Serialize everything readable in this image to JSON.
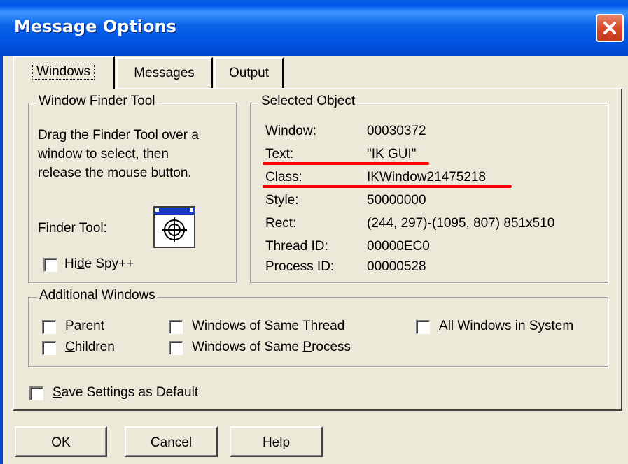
{
  "window": {
    "title": "Message Options"
  },
  "tabs": [
    {
      "label": "Windows"
    },
    {
      "label": "Messages"
    },
    {
      "label": "Output"
    }
  ],
  "finder": {
    "group_label": "Window Finder Tool",
    "instructions": [
      "Drag the Finder Tool over a",
      "window to select, then",
      "release the mouse button."
    ],
    "tool_label": "Finder Tool:",
    "hide_spy_pre": "Hi",
    "hide_spy_key": "d",
    "hide_spy_post": "e Spy++"
  },
  "selected": {
    "group_label": "Selected Object",
    "rows": [
      {
        "label": "Window:",
        "value": "00030372"
      },
      {
        "label_key": "T",
        "label_rest": "ext:",
        "value": "\"IK GUI\""
      },
      {
        "label_key": "C",
        "label_rest": "lass:",
        "value": "IKWindow21475218"
      },
      {
        "label": "Style:",
        "value": "50000000"
      },
      {
        "label": "Rect:",
        "value": "(244, 297)-(1095, 807) 851x510"
      },
      {
        "label": "Thread ID:",
        "value": "00000EC0"
      },
      {
        "label": "Process ID:",
        "value": "00000528"
      }
    ]
  },
  "additional": {
    "group_label": "Additional Windows",
    "parent_pre": "",
    "parent_key": "P",
    "parent_post": "arent",
    "children_pre": "",
    "children_key": "C",
    "children_post": "hildren",
    "same_thread_pre": "Windows of Same ",
    "same_thread_key": "T",
    "same_thread_post": "hread",
    "same_process_pre": "Windows of Same ",
    "same_process_key": "P",
    "same_process_post": "rocess",
    "all_windows_pre": "",
    "all_windows_key": "A",
    "all_windows_post": "ll Windows in System"
  },
  "save_default": {
    "key": "S",
    "rest": "ave Settings as Default"
  },
  "buttons": {
    "ok": "OK",
    "cancel": "Cancel",
    "help": "Help"
  },
  "colors": {
    "title_bar": "#0054e3",
    "close_button": "#d9492a",
    "annotation_line": "#ff0000",
    "dialog_bg": "#ece9d8"
  }
}
